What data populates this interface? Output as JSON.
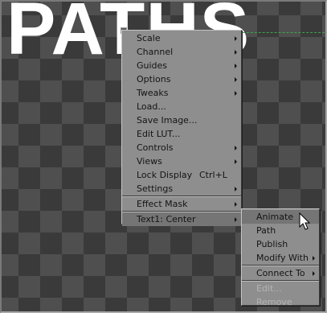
{
  "canvas": {
    "overlay_text": "PATHS",
    "colors": {
      "checker_light": "#4f4f4f",
      "checker_dark": "#3a3a3a",
      "overlay_text": "#ffffff",
      "guide_line": "#3fa34d",
      "menu_bg": "#8e8e8e",
      "menu_highlight": "#757575"
    }
  },
  "context_menu": {
    "items": [
      {
        "label": "Scale",
        "submenu": true
      },
      {
        "label": "Channel",
        "submenu": true
      },
      {
        "label": "Guides",
        "submenu": true
      },
      {
        "label": "Options",
        "submenu": true
      },
      {
        "label": "Tweaks",
        "submenu": true
      },
      {
        "label": "Load..."
      },
      {
        "label": "Save Image..."
      },
      {
        "label": "Edit LUT..."
      },
      {
        "label": "Controls",
        "submenu": true
      },
      {
        "label": "Views",
        "submenu": true
      },
      {
        "label": "Lock Display",
        "shortcut": "Ctrl+L"
      },
      {
        "label": "Settings",
        "submenu": true
      },
      {
        "label": "Effect Mask",
        "submenu": true
      },
      {
        "label": "Text1: Center",
        "submenu": true,
        "highlighted": true
      }
    ]
  },
  "submenu": {
    "items": [
      {
        "label": "Animate",
        "highlighted": true
      },
      {
        "label": "Path"
      },
      {
        "label": "Publish"
      },
      {
        "label": "Modify With",
        "submenu": true
      },
      {
        "label": "Connect To",
        "submenu": true
      },
      {
        "label": "Edit...",
        "disabled": true
      },
      {
        "label": "Remove",
        "disabled": true
      }
    ]
  },
  "cursor": {
    "icon": "arrow-cursor-icon"
  }
}
